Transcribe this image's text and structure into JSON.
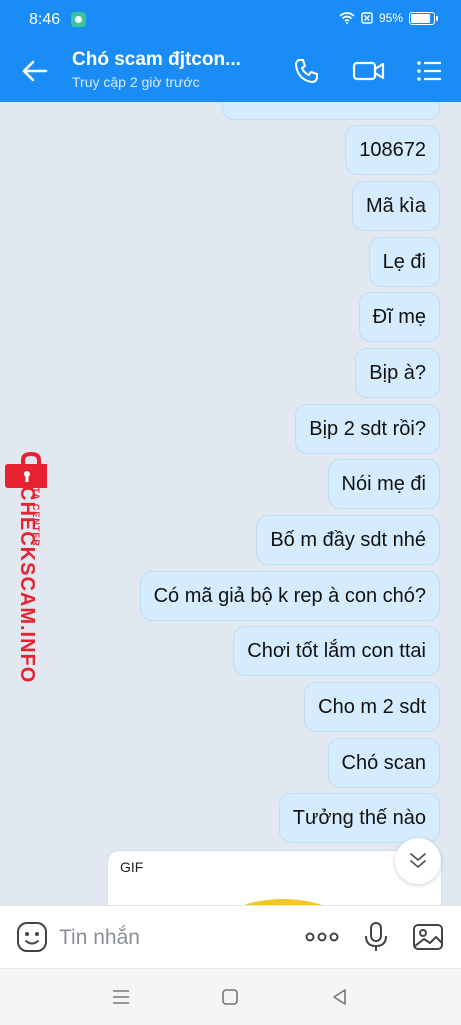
{
  "status_bar": {
    "time": "8:46",
    "battery_percent_label": "95%",
    "battery_level": 0.95
  },
  "header": {
    "title": "Chó scam đjtcon...",
    "subtitle": "Truy cập 2 giờ trước",
    "back_icon": "back-arrow-icon",
    "call_icon": "phone-icon",
    "video_icon": "video-call-icon",
    "menu_icon": "menu-list-icon"
  },
  "messages": [
    {
      "text": "108672"
    },
    {
      "text": "Mã kìa"
    },
    {
      "text": "Lẹ đi"
    },
    {
      "text": "Đĩ mẹ"
    },
    {
      "text": "Bịp à?"
    },
    {
      "text": "Bịp 2 sdt rồi?"
    },
    {
      "text": "Nói mẹ đi"
    },
    {
      "text": "Bố m đầy sdt nhé"
    },
    {
      "text": "Có mã giả bộ k rep à con chó?"
    },
    {
      "text": "Chơi tốt lắm con ttai"
    },
    {
      "text": "Cho m 2 sdt"
    },
    {
      "text": "Chó scan"
    },
    {
      "text": "Tưởng thế nào"
    }
  ],
  "gif": {
    "label": "GIF"
  },
  "watermark": {
    "brand": "CHECKSCAM.INFO",
    "sub": "DATA CENTER"
  },
  "input": {
    "placeholder": "Tin nhắn",
    "emoji_icon": "sticker-icon",
    "more_icon": "more-dots-icon",
    "mic_icon": "microphone-icon",
    "image_icon": "image-icon"
  },
  "colors": {
    "accent": "#1a8cf6",
    "bubble": "#d4ecfe",
    "watermark": "#e82130"
  }
}
